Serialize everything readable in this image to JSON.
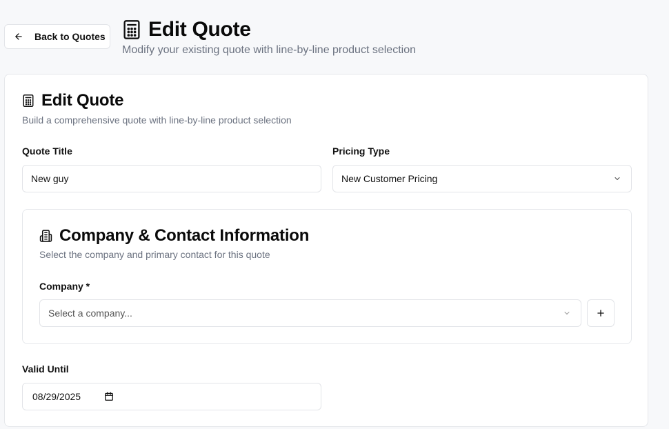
{
  "header": {
    "back_label": "Back to Quotes",
    "title": "Edit Quote",
    "subtitle": "Modify your existing quote with line-by-line product selection"
  },
  "card": {
    "title": "Edit Quote",
    "subtitle": "Build a comprehensive quote with line-by-line product selection",
    "quote_title": {
      "label": "Quote Title",
      "value": "New guy"
    },
    "pricing_type": {
      "label": "Pricing Type",
      "value": "New Customer Pricing"
    },
    "company_section": {
      "title": "Company & Contact Information",
      "subtitle": "Select the company and primary contact for this quote",
      "company_label": "Company *",
      "company_placeholder": "Select a company..."
    },
    "valid_until": {
      "label": "Valid Until",
      "value": "08/29/2025"
    }
  },
  "icons": {
    "back": "arrow-left-icon",
    "title": "calculator-icon",
    "company": "building-icon",
    "dropdown": "chevron-down-icon",
    "add": "plus-icon",
    "date": "calendar-icon"
  },
  "colors": {
    "background": "#f7f8fa",
    "card": "#ffffff",
    "border": "#e2e4e8",
    "muted_text": "#6b7280",
    "text": "#0a0a0a"
  }
}
